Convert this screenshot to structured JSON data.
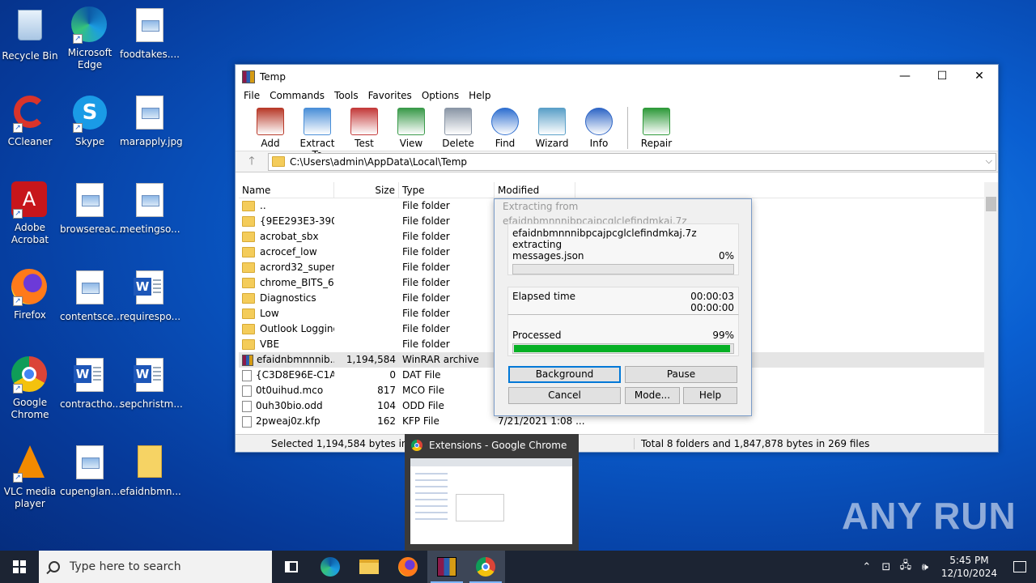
{
  "desktop": {
    "icons": [
      {
        "label": "Recycle Bin"
      },
      {
        "label": "Microsoft Edge"
      },
      {
        "label": "foodtakes...."
      },
      {
        "label": "CCleaner"
      },
      {
        "label": "Skype"
      },
      {
        "label": "marapply.jpg"
      },
      {
        "label": "Adobe Acrobat"
      },
      {
        "label": "browsereac..."
      },
      {
        "label": "meetingso..."
      },
      {
        "label": "Firefox"
      },
      {
        "label": "contentsce..."
      },
      {
        "label": "requirespo..."
      },
      {
        "label": "Google Chrome"
      },
      {
        "label": "contractho..."
      },
      {
        "label": "sepchristm..."
      },
      {
        "label": "VLC media player"
      },
      {
        "label": "cupenglan..."
      },
      {
        "label": "efaidnbmn..."
      }
    ]
  },
  "window": {
    "title": "Temp",
    "menu": [
      "File",
      "Commands",
      "Tools",
      "Favorites",
      "Options",
      "Help"
    ],
    "toolbar": [
      {
        "label": "Add",
        "color": "#b83a2a"
      },
      {
        "label": "Extract To",
        "color": "#4a8fd8"
      },
      {
        "label": "Test",
        "color": "#c43b3b"
      },
      {
        "label": "View",
        "color": "#3a9a4a"
      },
      {
        "label": "Delete",
        "color": "#8a96a6"
      },
      {
        "label": "Find",
        "color": "#2f6fd0"
      },
      {
        "label": "Wizard",
        "color": "#5aa0c8"
      },
      {
        "label": "Info",
        "color": "#2f66c6"
      },
      {
        "label": "Repair",
        "color": "#2f9a3a"
      }
    ],
    "address": "C:\\Users\\admin\\AppData\\Local\\Temp",
    "columns": {
      "name": "Name",
      "size": "Size",
      "type": "Type",
      "modified": "Modified"
    },
    "files": [
      {
        "name": "..",
        "size": "",
        "type": "File folder",
        "modified": "",
        "kind": "folder"
      },
      {
        "name": "{9EE293E3-390D...",
        "size": "",
        "type": "File folder",
        "modified": "",
        "kind": "folder"
      },
      {
        "name": "acrobat_sbx",
        "size": "",
        "type": "File folder",
        "modified": "",
        "kind": "folder"
      },
      {
        "name": "acrocef_low",
        "size": "",
        "type": "File folder",
        "modified": "",
        "kind": "folder"
      },
      {
        "name": "acrord32_super_...",
        "size": "",
        "type": "File folder",
        "modified": "",
        "kind": "folder"
      },
      {
        "name": "chrome_BITS_63...",
        "size": "",
        "type": "File folder",
        "modified": "",
        "kind": "folder"
      },
      {
        "name": "Diagnostics",
        "size": "",
        "type": "File folder",
        "modified": "",
        "kind": "folder"
      },
      {
        "name": "Low",
        "size": "",
        "type": "File folder",
        "modified": "",
        "kind": "folder"
      },
      {
        "name": "Outlook Logging",
        "size": "",
        "type": "File folder",
        "modified": "",
        "kind": "folder"
      },
      {
        "name": "VBE",
        "size": "",
        "type": "File folder",
        "modified": "",
        "kind": "folder"
      },
      {
        "name": "efaidnbmnnnib...",
        "size": "1,194,584",
        "type": "WinRAR archive",
        "modified": "",
        "kind": "rar",
        "selected": true
      },
      {
        "name": "{C3D8E96E-C1A...",
        "size": "0",
        "type": "DAT File",
        "modified": "",
        "kind": "file"
      },
      {
        "name": "0t0uihud.mco",
        "size": "817",
        "type": "MCO File",
        "modified": "",
        "kind": "file"
      },
      {
        "name": "0uh30bio.odd",
        "size": "104",
        "type": "ODD File",
        "modified": "",
        "kind": "file"
      },
      {
        "name": "2pweaj0z.kfp",
        "size": "162",
        "type": "KFP File",
        "modified": "7/21/2021 1:08 ...",
        "kind": "file"
      }
    ],
    "status_left": "Selected 1,194,584 bytes in 1 file",
    "status_right": "Total 8 folders and 1,847,878 bytes in 269 files"
  },
  "dialog": {
    "title": "Extracting from efaidnbmnnnibpcajpcglclefindmkaj.7z",
    "archive": "efaidnbmnnnibpcajpcglclefindmkaj.7z",
    "action": "extracting",
    "current_file": "messages.json",
    "file_percent": "0%",
    "file_progress": 0,
    "elapsed_label": "Elapsed time",
    "elapsed": "00:00:03",
    "remaining": "00:00:00",
    "processed_label": "Processed",
    "processed_percent": "99%",
    "processed_progress": 0.99,
    "buttons": {
      "background": "Background",
      "pause": "Pause",
      "cancel": "Cancel",
      "mode": "Mode...",
      "help": "Help"
    }
  },
  "preview": {
    "title": "Extensions - Google Chrome"
  },
  "watermark": "ANY RUN",
  "taskbar": {
    "search_placeholder": "Type here to search",
    "time": "5:45 PM",
    "date": "12/10/2024"
  }
}
